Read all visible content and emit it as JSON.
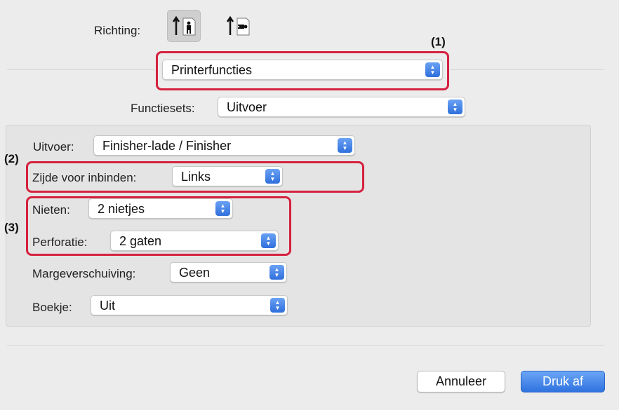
{
  "orientation": {
    "label": "Richting:",
    "options": [
      "portrait-icon",
      "landscape-icon"
    ],
    "selected": "portrait-icon"
  },
  "section_popup": {
    "value": "Printerfuncties"
  },
  "feature_sets": {
    "label": "Functiesets:",
    "value": "Uitvoer"
  },
  "settings": {
    "output": {
      "label": "Uitvoer:",
      "value": "Finisher-lade / Finisher"
    },
    "binding_edge": {
      "label": "Zijde voor inbinden:",
      "value": "Links"
    },
    "staple": {
      "label": "Nieten:",
      "value": "2 nietjes"
    },
    "punch": {
      "label": "Perforatie:",
      "value": "2 gaten"
    },
    "margin_shift": {
      "label": "Margeverschuiving:",
      "value": "Geen"
    },
    "booklet": {
      "label": "Boekje:",
      "value": "Uit"
    }
  },
  "callouts": {
    "one": "(1)",
    "two": "(2)",
    "three": "(3)"
  },
  "colors": {
    "callout": "#d5213f",
    "accent": "#2f73e0"
  },
  "buttons": {
    "cancel": "Annuleer",
    "print": "Druk af"
  }
}
